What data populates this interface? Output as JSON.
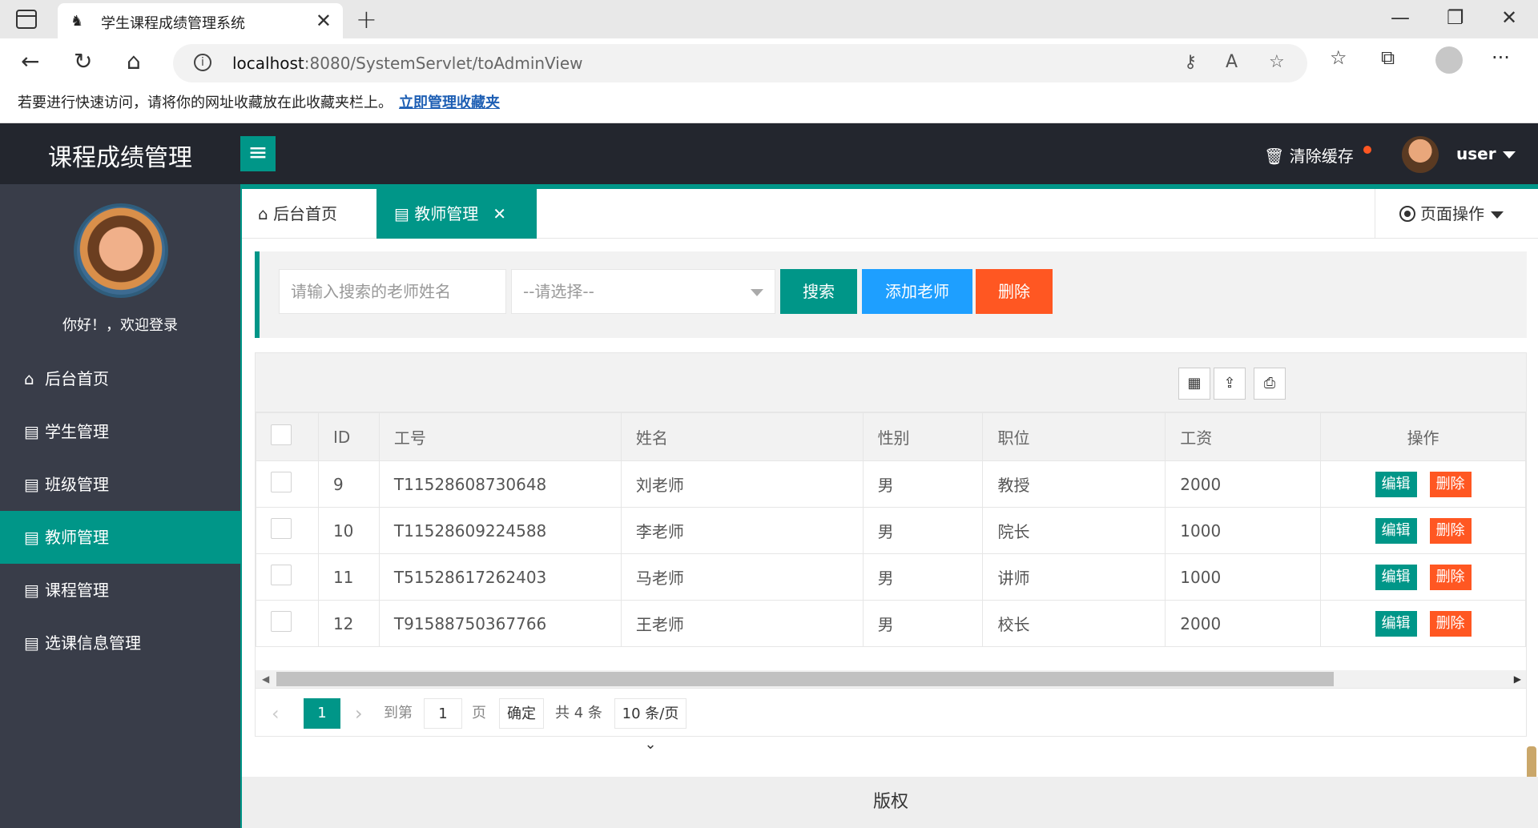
{
  "browser": {
    "tab_title": "学生课程成绩管理系统",
    "url_host": "localhost",
    "url_path": ":8080/SystemServlet/toAdminView",
    "fav_message": "若要进行快速访问，请将你的网址收藏放在此收藏夹栏上。",
    "fav_link": "立即管理收藏夹"
  },
  "header": {
    "logo": "课程成绩管理",
    "clear_cache": "清除缓存",
    "username": "user"
  },
  "sidebar": {
    "welcome": "你好！，欢迎登录",
    "items": [
      {
        "label": "后台首页"
      },
      {
        "label": "学生管理"
      },
      {
        "label": "班级管理"
      },
      {
        "label": "教师管理"
      },
      {
        "label": "课程管理"
      },
      {
        "label": "选课信息管理"
      }
    ]
  },
  "tabs": {
    "home": "后台首页",
    "active": "教师管理",
    "page_ops": "页面操作"
  },
  "search": {
    "placeholder": "请输入搜索的老师姓名",
    "select_value": "--请选择--",
    "search_btn": "搜索",
    "add_btn": "添加老师",
    "delete_btn": "删除"
  },
  "table": {
    "headers": [
      "ID",
      "工号",
      "姓名",
      "性别",
      "职位",
      "工资",
      "操作"
    ],
    "rows": [
      {
        "id": "9",
        "no": "T11528608730648",
        "name": "刘老师",
        "gender": "男",
        "position": "教授",
        "salary": "2000"
      },
      {
        "id": "10",
        "no": "T11528609224588",
        "name": "李老师",
        "gender": "男",
        "position": "院长",
        "salary": "1000"
      },
      {
        "id": "11",
        "no": "T51528617262403",
        "name": "马老师",
        "gender": "男",
        "position": "讲师",
        "salary": "1000"
      },
      {
        "id": "12",
        "no": "T91588750367766",
        "name": "王老师",
        "gender": "男",
        "position": "校长",
        "salary": "2000"
      }
    ],
    "edit_label": "编辑",
    "delete_label": "删除"
  },
  "pager": {
    "current": "1",
    "goto_label": "到第",
    "goto_value": "1",
    "page_unit": "页",
    "confirm": "确定",
    "total": "共 4 条",
    "page_size": "10 条/页"
  },
  "footer": {
    "text": "版权"
  }
}
